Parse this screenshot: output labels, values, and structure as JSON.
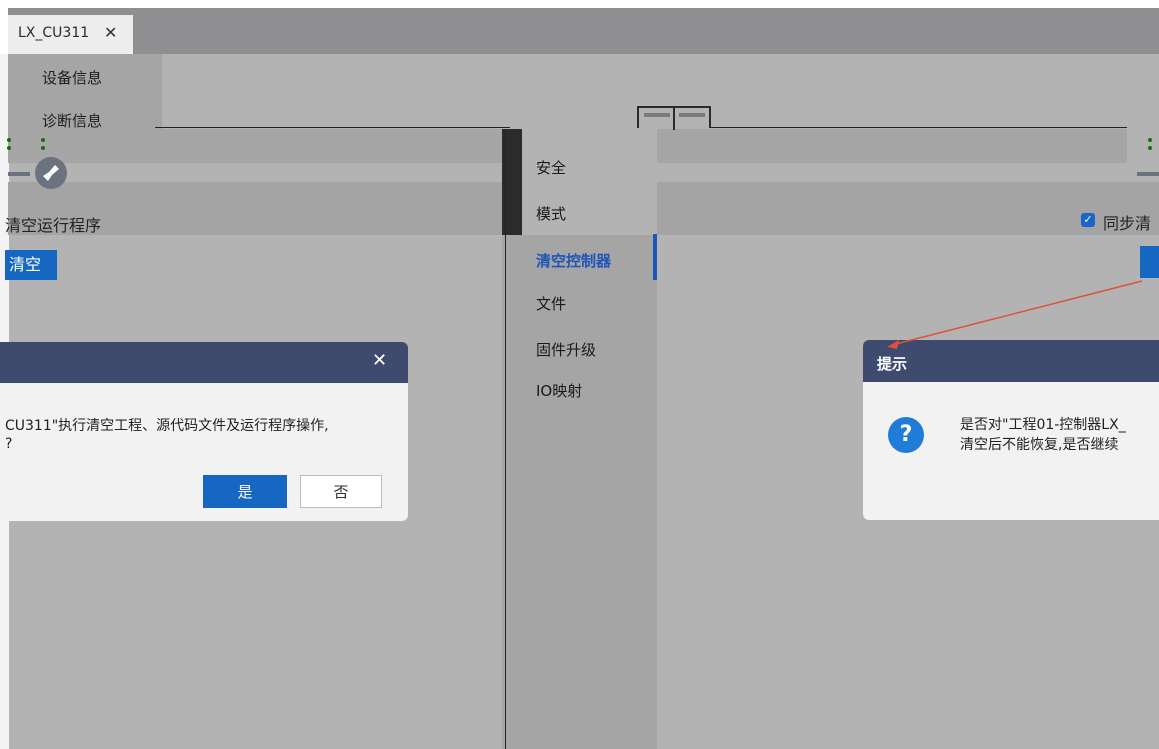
{
  "tab": {
    "label": "LX_CU311",
    "close_glyph": "✕"
  },
  "menu": {
    "items": [
      {
        "label": "设备信息"
      },
      {
        "label": "诊断信息"
      }
    ]
  },
  "nav": {
    "items": [
      {
        "label": "安全"
      },
      {
        "label": "模式"
      },
      {
        "label": "清空控制器"
      },
      {
        "label": "文件"
      },
      {
        "label": "固件升级"
      },
      {
        "label": "IO映射"
      }
    ]
  },
  "left_panel": {
    "clear_label": "清空运行程序",
    "clear_button": "清空"
  },
  "right_panel": {
    "sync_label": "同步清",
    "checkbox_mark": "✓"
  },
  "dialog_left": {
    "close": "✕",
    "text_line1": "CU311\"执行清空工程、源代码文件及运行程序操作,",
    "text_line2": "?",
    "yes": "是",
    "no": "否"
  },
  "dialog_right": {
    "title": "提示",
    "icon": "?",
    "text_line1": "是否对\"工程01-控制器LX_",
    "text_line2": "清空后不能恢复,是否继续"
  },
  "colors": {
    "accent": "#1667c1",
    "dialog_header": "#3f4b6e",
    "annotation_arrow": "#e0503a"
  }
}
